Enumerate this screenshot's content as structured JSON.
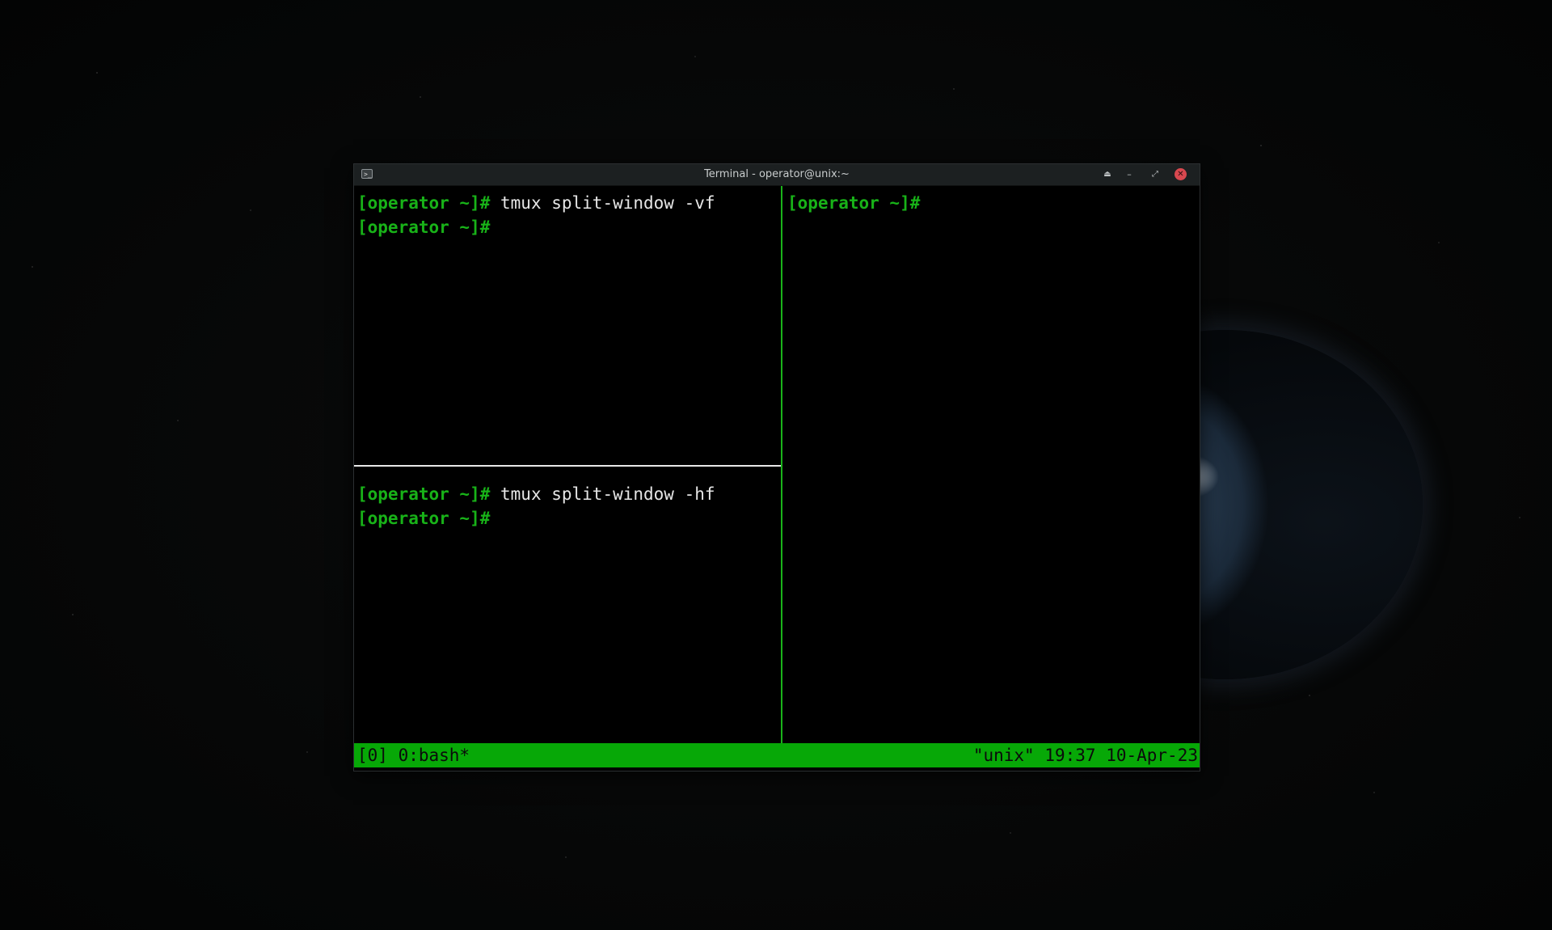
{
  "window": {
    "title": "Terminal - operator@unix:~",
    "app_icon_glyph": ">_",
    "buttons": {
      "keep_above_glyph": "⏏",
      "minimize_glyph": "–",
      "maximize_glyph": "⤢",
      "close_glyph": "✕"
    }
  },
  "panes": {
    "top_left": [
      {
        "prompt": "[operator ~]#",
        "command": " tmux split-window -vf"
      },
      {
        "prompt": "[operator ~]#",
        "command": ""
      }
    ],
    "bottom_left": [
      {
        "prompt": "[operator ~]#",
        "command": " tmux split-window -hf"
      },
      {
        "prompt": "[operator ~]#",
        "command": ""
      }
    ],
    "right": [
      {
        "prompt": "[operator ~]#",
        "command": ""
      }
    ]
  },
  "statusbar": {
    "left": "[0] 0:bash*",
    "right": "\"unix\" 19:37 10-Apr-23"
  },
  "colors": {
    "prompt": "#18b218",
    "statusbar_bg": "#07a807",
    "pane_border_active": "#1ab41a",
    "pane_border_inactive": "#e8e8e8",
    "close_button": "#d8484f"
  }
}
